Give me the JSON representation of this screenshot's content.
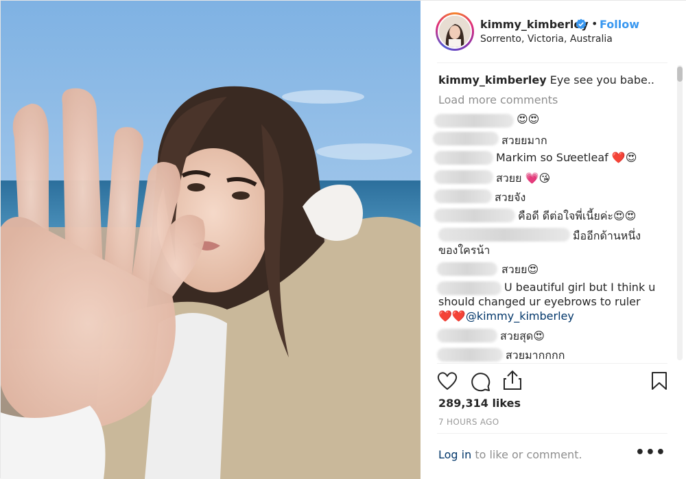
{
  "post": {
    "username": "kimmy_kimberley",
    "follow_label": "Follow",
    "separator": "•",
    "location": "Sorrento, Victoria, Australia"
  },
  "caption": {
    "username": "kimmy_kimberley",
    "text": "Eye see you babe.."
  },
  "load_more_label": "Load more comments",
  "comments": [
    {
      "text": "😍😍"
    },
    {
      "text": "สวยยมาก"
    },
    {
      "text": "Markim so Sưeetleaf ❤️😍"
    },
    {
      "text": "สวยย 💗😘"
    },
    {
      "text": "สวยจัง"
    },
    {
      "text": "คือดี ดีต่อใจพี่เนี้ยค่ะ😍😍"
    },
    {
      "text_line1": "มืออีกด้านหนึ่ง",
      "text_line2": "ของใครน้า"
    },
    {
      "text": "สวยย😍"
    },
    {
      "text_line1": "U beautiful girl but I think u",
      "text_line2": "should changed ur eyebrows to ruler",
      "hearts": "❤️❤️",
      "mention": "@kimmy_kimberley"
    },
    {
      "text": "สวยสุด😍"
    },
    {
      "text": "สวยมากกกก"
    }
  ],
  "likes": "289,314 likes",
  "time_ago": "7 HOURS AGO",
  "login": {
    "link_label": "Log in",
    "rest": " to like or comment."
  },
  "more_label": "•••",
  "colors": {
    "follow": "#3897f0",
    "link": "#003569",
    "secondary_text": "#8e8e8e",
    "verified": "#3897f0"
  },
  "icons": [
    "heart-icon",
    "comment-icon",
    "share-icon",
    "bookmark-icon",
    "verified-badge-icon",
    "more-options-icon"
  ]
}
